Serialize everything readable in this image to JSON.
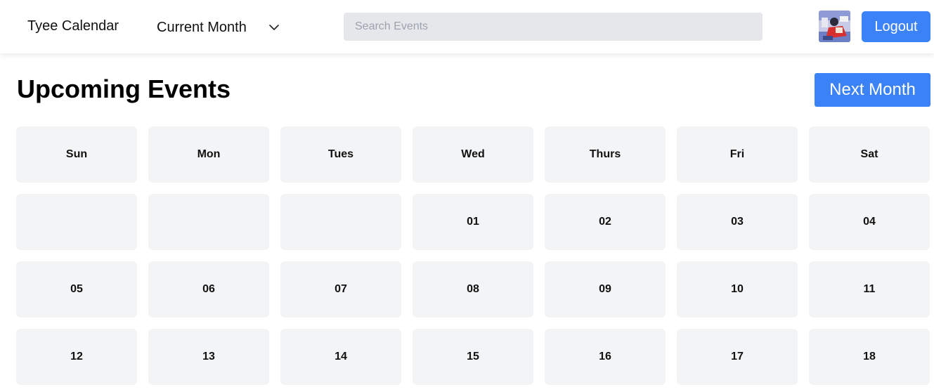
{
  "header": {
    "brand": "Tyee Calendar",
    "month_selector": "Current Month",
    "search_placeholder": "Search Events",
    "search_value": "",
    "logout_label": "Logout"
  },
  "main": {
    "title": "Upcoming Events",
    "next_month_label": "Next Month"
  },
  "calendar": {
    "weekdays": [
      "Sun",
      "Mon",
      "Tues",
      "Wed",
      "Thurs",
      "Fri",
      "Sat"
    ],
    "weeks": [
      [
        "",
        "",
        "",
        "01",
        "02",
        "03",
        "04"
      ],
      [
        "05",
        "06",
        "07",
        "08",
        "09",
        "10",
        "11"
      ],
      [
        "12",
        "13",
        "14",
        "15",
        "16",
        "17",
        "18"
      ]
    ]
  },
  "colors": {
    "accent": "#3b82f6",
    "cell_background": "#f3f4f6",
    "search_background": "#e5e7eb"
  },
  "icons": {
    "month_dropdown": "chevron-down-icon",
    "avatar": "user-avatar-image"
  }
}
